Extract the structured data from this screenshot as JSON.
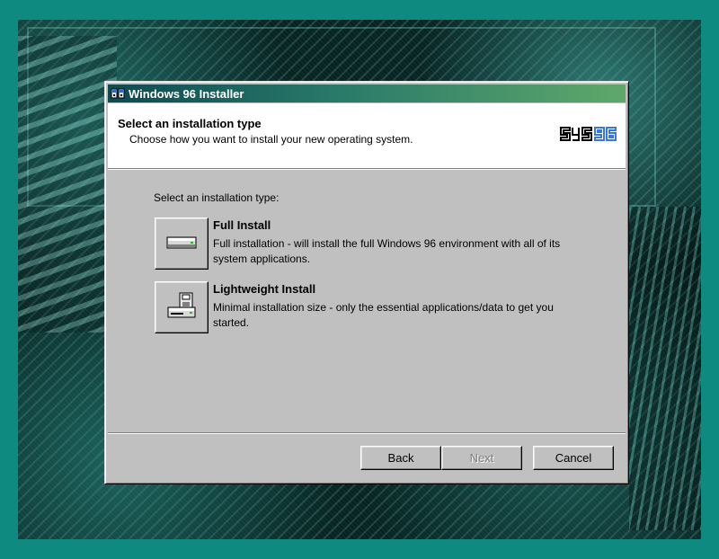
{
  "window": {
    "title": "Windows 96 Installer",
    "icon": "installer-icon"
  },
  "header": {
    "title": "Select an installation type",
    "subtitle": "Choose how you want to install your new operating system.",
    "logo": "SYS96"
  },
  "main": {
    "section_label": "Select an installation type:",
    "options": [
      {
        "title": "Full Install",
        "description": "Full installation - will install the full Windows 96 environment with all of its system applications.",
        "icon": "hard-drive-icon"
      },
      {
        "title": "Lightweight Install",
        "description": "Minimal installation size - only the essential applications/data to get you started.",
        "icon": "floppy-install-icon"
      }
    ]
  },
  "footer": {
    "back_label": "Back",
    "next_label": "Next",
    "cancel_label": "Cancel"
  },
  "colors": {
    "desktop": "#0f8a80",
    "titlebar_start": "#0d4a52",
    "titlebar_end": "#5fa86a",
    "window_face": "#c0c0c0",
    "logo_blue": "#3a78d8"
  }
}
